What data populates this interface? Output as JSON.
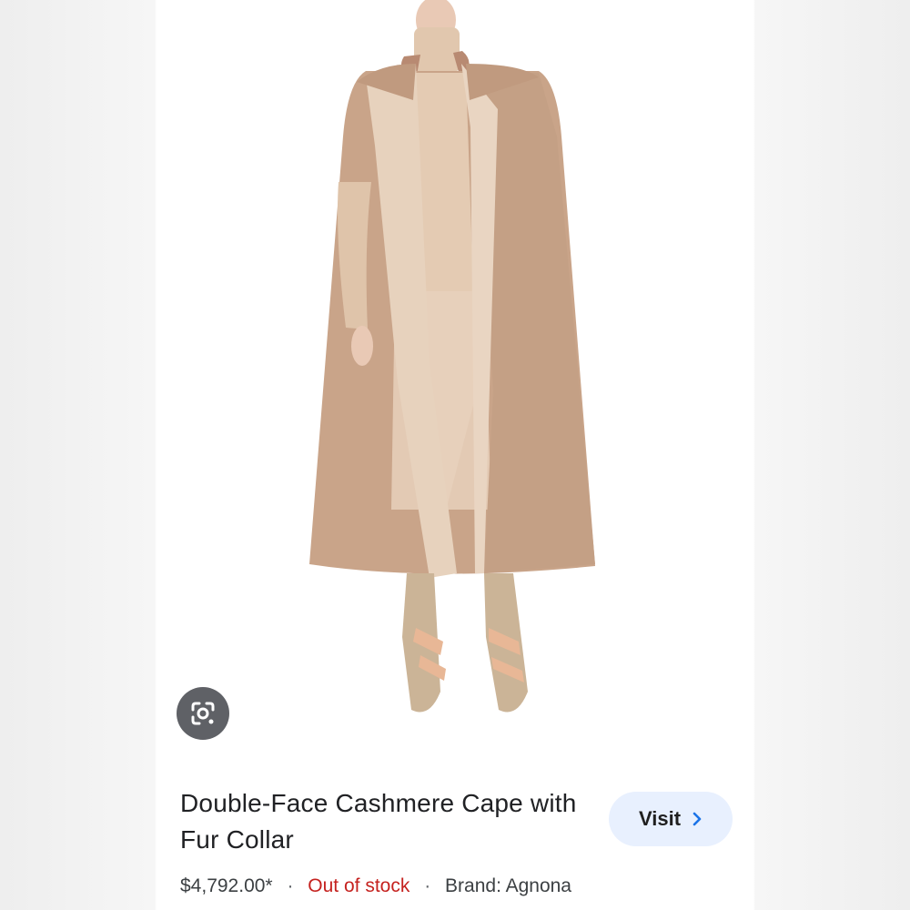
{
  "product": {
    "title": "Double-Face Cashmere Cape with Fur Collar",
    "price": "$4,792.00*",
    "stock_status": "Out of stock",
    "brand": "Brand: Agnona",
    "separator": "·"
  },
  "actions": {
    "visit_label": "Visit",
    "visit_icon": "chevron-right-icon",
    "lens_icon": "google-lens-icon"
  },
  "colors": {
    "stock_red": "#c5221f",
    "visit_bg": "#e8f0fe",
    "chevron_blue": "#1a73e8",
    "cape": "#c9a489",
    "lapel": "#e7d2bd"
  }
}
